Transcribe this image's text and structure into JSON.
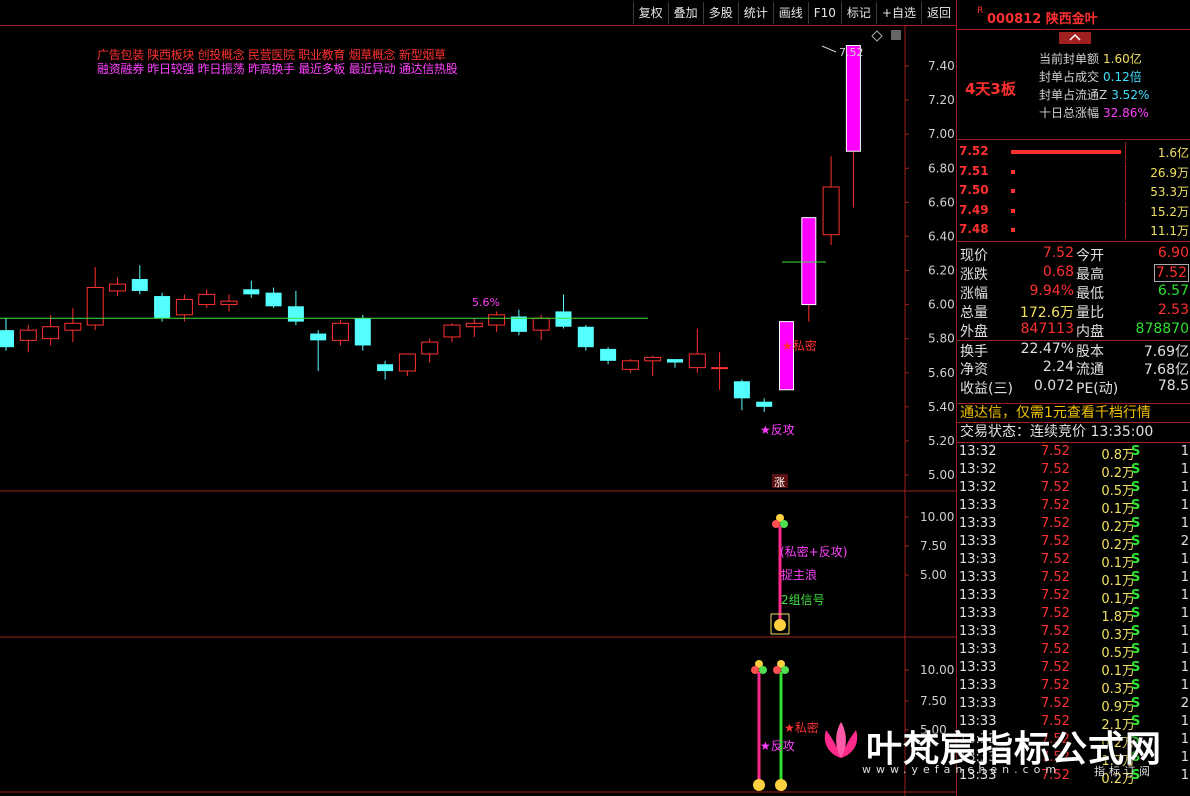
{
  "toolbar": {
    "items": [
      "复权",
      "叠加",
      "多股",
      "统计",
      "画线",
      "F10",
      "标记",
      "+自选",
      "返回"
    ]
  },
  "tags": {
    "line1": "广告包装    陕西板块    创投概念 民营医院 职业教育 烟草概念 新型烟草",
    "line2": "融资融券 昨日较强 昨日振荡 昨高换手 最近多板 最近异动 通达信热股"
  },
  "colors": {
    "up": "#ff3030",
    "down": "#54ffff",
    "signal": "#ff00ff",
    "ma": "#40e040",
    "border": "#a02020"
  },
  "main_chart": {
    "price_labels": [
      "7.40",
      "7.20",
      "7.00",
      "6.80",
      "6.60",
      "6.40",
      "6.20",
      "6.00",
      "5.80",
      "5.60",
      "5.40",
      "5.20",
      "5.00"
    ],
    "last_price_label": "7.52",
    "pct_label": "5.6%",
    "annotations": {
      "simi": "★私密",
      "fangong": "★反攻",
      "zhang": "涨"
    },
    "candles": [
      [
        5.85,
        5.75,
        5.92,
        5.73
      ],
      [
        5.79,
        5.85,
        5.88,
        5.72
      ],
      [
        5.8,
        5.87,
        5.94,
        5.76
      ],
      [
        5.85,
        5.89,
        5.98,
        5.78
      ],
      [
        5.88,
        6.1,
        6.22,
        5.85
      ],
      [
        6.08,
        6.12,
        6.16,
        6.05
      ],
      [
        6.15,
        6.08,
        6.23,
        6.06
      ],
      [
        6.05,
        5.92,
        6.07,
        5.9
      ],
      [
        5.94,
        6.03,
        6.06,
        5.9
      ],
      [
        6.0,
        6.06,
        6.09,
        5.98
      ],
      [
        6.0,
        6.02,
        6.06,
        5.96
      ],
      [
        6.09,
        6.06,
        6.14,
        6.04
      ],
      [
        6.07,
        5.99,
        6.1,
        5.98
      ],
      [
        5.99,
        5.9,
        6.08,
        5.88
      ],
      [
        5.83,
        5.79,
        5.85,
        5.61
      ],
      [
        5.79,
        5.89,
        5.91,
        5.76
      ],
      [
        5.92,
        5.76,
        5.94,
        5.73
      ],
      [
        5.65,
        5.61,
        5.67,
        5.56
      ],
      [
        5.61,
        5.71,
        5.71,
        5.58
      ],
      [
        5.71,
        5.78,
        5.8,
        5.66
      ],
      [
        5.81,
        5.88,
        5.89,
        5.78
      ],
      [
        5.87,
        5.89,
        5.92,
        5.81
      ],
      [
        5.88,
        5.94,
        5.96,
        5.84
      ],
      [
        5.93,
        5.84,
        5.97,
        5.82
      ],
      [
        5.85,
        5.92,
        5.94,
        5.79
      ],
      [
        5.96,
        5.87,
        6.06,
        5.86
      ],
      [
        5.87,
        5.75,
        5.88,
        5.73
      ],
      [
        5.74,
        5.67,
        5.75,
        5.65
      ],
      [
        5.62,
        5.67,
        5.68,
        5.6
      ],
      [
        5.67,
        5.69,
        5.7,
        5.58
      ],
      [
        5.68,
        5.66,
        5.68,
        5.63
      ],
      [
        5.63,
        5.71,
        5.86,
        5.6
      ],
      [
        5.63,
        5.63,
        5.72,
        5.5
      ],
      [
        5.55,
        5.45,
        5.56,
        5.38
      ],
      [
        5.43,
        5.4,
        5.45,
        5.37
      ],
      [
        5.5,
        5.9,
        5.9,
        5.5
      ],
      [
        6.0,
        6.51,
        6.51,
        5.9
      ],
      [
        6.41,
        6.69,
        6.87,
        6.35
      ],
      [
        6.9,
        7.52,
        7.52,
        6.57
      ]
    ],
    "ma_level": 5.92
  },
  "sub1": {
    "labels": [
      "10.00",
      "7.50",
      "5.00"
    ],
    "texts": [
      "(私密+反攻)",
      "捉主浪",
      "2组信号"
    ]
  },
  "sub2": {
    "labels": [
      "10.00",
      "7.50",
      "5.00"
    ],
    "texts": [
      "★私密",
      "★反攻"
    ]
  },
  "stock": {
    "r": "R",
    "code": "000812 陕西金叶"
  },
  "info": {
    "limit_label": "4天3板",
    "lines": [
      {
        "label": "当前封单额",
        "value": "1.60亿"
      },
      {
        "label": "封单占成交",
        "value": "0.12倍"
      },
      {
        "label": "封单占流通Z",
        "value": "3.52%"
      },
      {
        "label": "十日总涨幅",
        "value": "32.86%"
      }
    ]
  },
  "order_book": [
    {
      "price": "7.52",
      "vol": "1.6亿"
    },
    {
      "price": "7.51",
      "vol": "26.9万"
    },
    {
      "price": "7.50",
      "vol": "53.3万"
    },
    {
      "price": "7.49",
      "vol": "15.2万"
    },
    {
      "price": "7.48",
      "vol": "11.1万"
    }
  ],
  "quote": [
    {
      "l1": "现价",
      "v1": "7.52",
      "l2": "今开",
      "v2": "6.90"
    },
    {
      "l1": "涨跌",
      "v1": "0.68",
      "l2": "最高",
      "v2": "7.52"
    },
    {
      "l1": "涨幅",
      "v1": "9.94%",
      "l2": "最低",
      "v2": "6.57"
    },
    {
      "l1": "总量",
      "v1": "172.6万",
      "l2": "量比",
      "v2": "2.53"
    },
    {
      "l1": "外盘",
      "v1": "847113",
      "l2": "内盘",
      "v2": "878870"
    },
    {
      "l1": "换手",
      "v1": "22.47%",
      "l2": "股本",
      "v2": "7.69亿"
    },
    {
      "l1": "净资",
      "v1": "2.24",
      "l2": "流通",
      "v2": "7.68亿"
    },
    {
      "l1": "收益(三)",
      "v1": "0.072",
      "l2": "PE(动)",
      "v2": "78.5"
    }
  ],
  "ad": "通达信，仅需1元查看千档行情",
  "trade_state": "交易状态：连续竞价 13:35:00",
  "ticks": [
    [
      "13:32",
      "7.52",
      "0.8万",
      "S",
      "1"
    ],
    [
      "13:32",
      "7.52",
      "0.2万",
      "S",
      "1"
    ],
    [
      "13:32",
      "7.52",
      "0.5万",
      "S",
      "1"
    ],
    [
      "13:33",
      "7.52",
      "0.1万",
      "S",
      "1"
    ],
    [
      "13:33",
      "7.52",
      "0.2万",
      "S",
      "1"
    ],
    [
      "13:33",
      "7.52",
      "0.2万",
      "S",
      "2"
    ],
    [
      "13:33",
      "7.52",
      "0.1万",
      "S",
      "1"
    ],
    [
      "13:33",
      "7.52",
      "0.1万",
      "S",
      "1"
    ],
    [
      "13:33",
      "7.52",
      "0.1万",
      "S",
      "1"
    ],
    [
      "13:33",
      "7.52",
      "1.8万",
      "S",
      "1"
    ],
    [
      "13:33",
      "7.52",
      "0.3万",
      "S",
      "1"
    ],
    [
      "13:33",
      "7.52",
      "0.5万",
      "S",
      "1"
    ],
    [
      "13:33",
      "7.52",
      "0.1万",
      "S",
      "1"
    ],
    [
      "13:33",
      "7.52",
      "0.3万",
      "S",
      "1"
    ],
    [
      "13:33",
      "7.52",
      "0.9万",
      "S",
      "2"
    ],
    [
      "13:33",
      "7.52",
      "2.1万",
      "S",
      "1"
    ],
    [
      "13:33",
      "7.52",
      "0.2万",
      "S",
      "1"
    ],
    [
      "13:33",
      "7.52",
      "1.7万",
      "S",
      "1"
    ],
    [
      "13:33",
      "7.52",
      "0.2万",
      "S",
      "1"
    ]
  ],
  "watermark": {
    "title": "叶梵宸指标公式网",
    "url": "www.yefanchen.com",
    "sub": "指标订阅"
  }
}
